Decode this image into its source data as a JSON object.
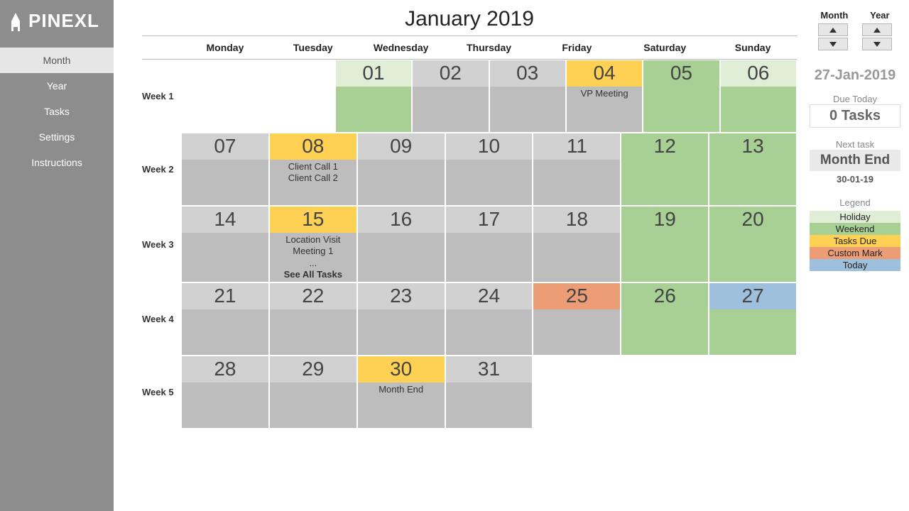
{
  "app": {
    "name": "PINEXL"
  },
  "sidebar": {
    "items": [
      {
        "label": "Month",
        "selected": true
      },
      {
        "label": "Year"
      },
      {
        "label": "Tasks"
      },
      {
        "label": "Settings"
      },
      {
        "label": "Instructions"
      }
    ]
  },
  "calendar": {
    "title": "January 2019",
    "day_labels": [
      "Monday",
      "Tuesday",
      "Wednesday",
      "Thursday",
      "Friday",
      "Saturday",
      "Sunday"
    ],
    "week_labels": [
      "Week 1",
      "Week 2",
      "Week 3",
      "Week 4",
      "Week 5"
    ],
    "weeks": [
      [
        null,
        null,
        {
          "num": "01",
          "type": "holiday"
        },
        {
          "num": "02",
          "type": "normal"
        },
        {
          "num": "03",
          "type": "normal"
        },
        {
          "num": "04",
          "type": "task",
          "tasks": [
            "VP Meeting"
          ]
        },
        {
          "num": "05",
          "type": "weekend"
        },
        {
          "num": "06",
          "type": "holiday"
        }
      ],
      [
        {
          "num": "07",
          "type": "normal"
        },
        {
          "num": "08",
          "type": "task",
          "tasks": [
            "Client Call 1",
            "Client Call 2"
          ]
        },
        {
          "num": "09",
          "type": "normal"
        },
        {
          "num": "10",
          "type": "normal"
        },
        {
          "num": "11",
          "type": "normal"
        },
        {
          "num": "12",
          "type": "weekend"
        },
        {
          "num": "13",
          "type": "weekend"
        }
      ],
      [
        {
          "num": "14",
          "type": "normal"
        },
        {
          "num": "15",
          "type": "task",
          "tasks": [
            "Location Visit",
            "Meeting 1",
            "..."
          ],
          "see_all": "See All Tasks"
        },
        {
          "num": "16",
          "type": "normal"
        },
        {
          "num": "17",
          "type": "normal"
        },
        {
          "num": "18",
          "type": "normal"
        },
        {
          "num": "19",
          "type": "weekend"
        },
        {
          "num": "20",
          "type": "weekend"
        }
      ],
      [
        {
          "num": "21",
          "type": "normal"
        },
        {
          "num": "22",
          "type": "normal"
        },
        {
          "num": "23",
          "type": "normal"
        },
        {
          "num": "24",
          "type": "normal"
        },
        {
          "num": "25",
          "type": "custom"
        },
        {
          "num": "26",
          "type": "weekend"
        },
        {
          "num": "27",
          "type": "today"
        }
      ],
      [
        {
          "num": "28",
          "type": "normal"
        },
        {
          "num": "29",
          "type": "normal"
        },
        {
          "num": "30",
          "type": "task",
          "tasks": [
            "Month End"
          ]
        },
        {
          "num": "31",
          "type": "normal"
        },
        null,
        null,
        null
      ]
    ]
  },
  "controls": {
    "month_label": "Month",
    "year_label": "Year",
    "current_date": "27-Jan-2019",
    "due_today_label": "Due Today",
    "due_today_value": "0 Tasks",
    "next_task_label": "Next task",
    "next_task_name": "Month End",
    "next_task_date": "30-01-19"
  },
  "legend": {
    "title": "Legend",
    "items": [
      {
        "label": "Holiday",
        "color": "#e0eed8"
      },
      {
        "label": "Weekend",
        "color": "#a8cf94"
      },
      {
        "label": "Tasks Due",
        "color": "#fed053"
      },
      {
        "label": "Custom Mark",
        "color": "#ec9d76"
      },
      {
        "label": "Today",
        "color": "#9fc0dd"
      }
    ]
  }
}
